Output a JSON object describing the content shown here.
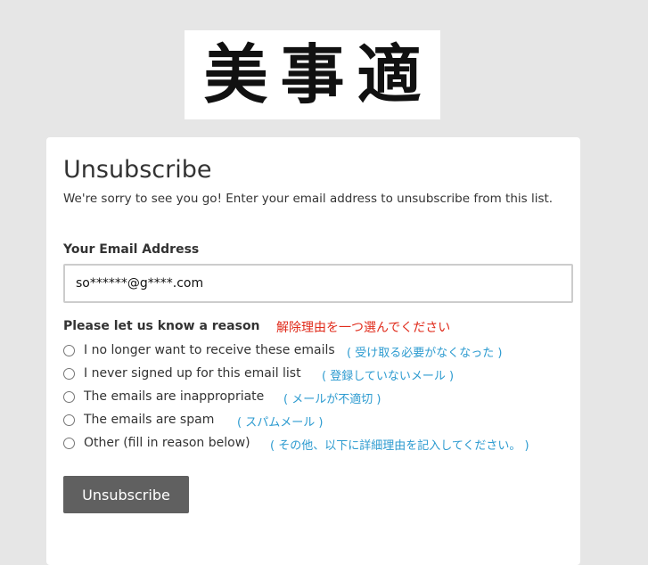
{
  "logo": {
    "text": "美事適"
  },
  "form": {
    "title": "Unsubscribe",
    "description": "We're sorry to see you go! Enter your email address to unsubscribe from this list.",
    "email_label": "Your Email Address",
    "email_value": "so******@g****.com",
    "reason_label": "Please let us know a reason",
    "reason_label_jp": "解除理由を一つ選んでください",
    "options": [
      {
        "label": "I no longer want to receive these emails",
        "jp": "( 受け取る必要がなくなった )"
      },
      {
        "label": "I never signed up for this email list",
        "jp": "( 登録していないメール )"
      },
      {
        "label": "The emails are inappropriate",
        "jp": "( メールが不適切 )"
      },
      {
        "label": "The emails are spam",
        "jp": "( スパムメール )"
      },
      {
        "label": "Other (fill in reason below)",
        "jp": "( その他、以下に詳細理由を記入してください。 )"
      }
    ],
    "submit_label": "Unsubscribe"
  },
  "colors": {
    "background": "#e6e6e6",
    "jp_hint": "#2d9bd0",
    "jp_required": "#e02a1a",
    "button": "#606060"
  }
}
